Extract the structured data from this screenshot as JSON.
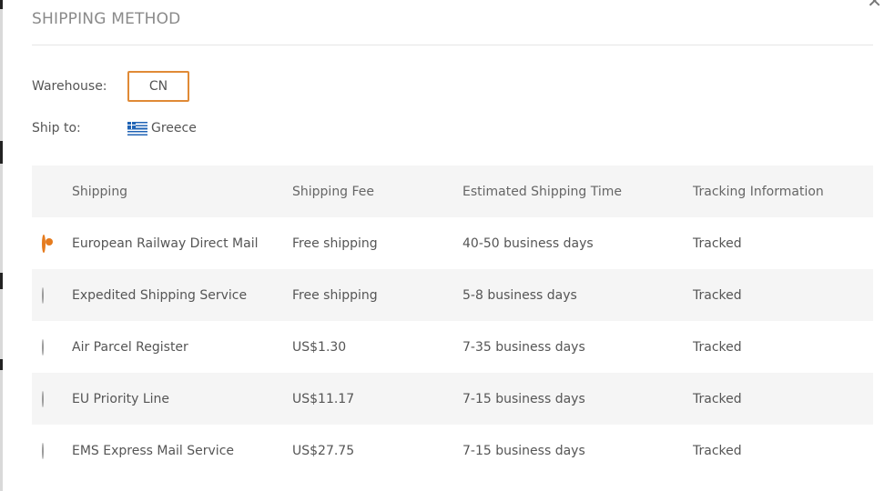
{
  "dialog": {
    "title": "SHIPPING METHOD",
    "close_icon": "close-icon"
  },
  "warehouse": {
    "label": "Warehouse:",
    "value": "CN"
  },
  "ship_to": {
    "label": "Ship to:",
    "country": "Greece",
    "flag_icon": "greece-flag-icon"
  },
  "table": {
    "headers": {
      "shipping": "Shipping",
      "fee": "Shipping Fee",
      "time": "Estimated Shipping Time",
      "tracking": "Tracking Information"
    },
    "rows": [
      {
        "name": "European Railway Direct Mail",
        "fee": "Free shipping",
        "time": "40-50 business days",
        "tracking": "Tracked",
        "selected": true
      },
      {
        "name": "Expedited Shipping Service",
        "fee": "Free shipping",
        "time": "5-8 business days",
        "tracking": "Tracked",
        "selected": false
      },
      {
        "name": "Air Parcel Register",
        "fee": "US$1.30",
        "time": "7-35 business days",
        "tracking": "Tracked",
        "selected": false
      },
      {
        "name": "EU Priority Line",
        "fee": "US$11.17",
        "time": "7-15 business days",
        "tracking": "Tracked",
        "selected": false
      },
      {
        "name": "EMS Express Mail Service",
        "fee": "US$27.75",
        "time": "7-15 business days",
        "tracking": "Tracked",
        "selected": false
      }
    ]
  },
  "colors": {
    "accent": "#e57b1e",
    "row_shade": "#f5f5f5"
  }
}
